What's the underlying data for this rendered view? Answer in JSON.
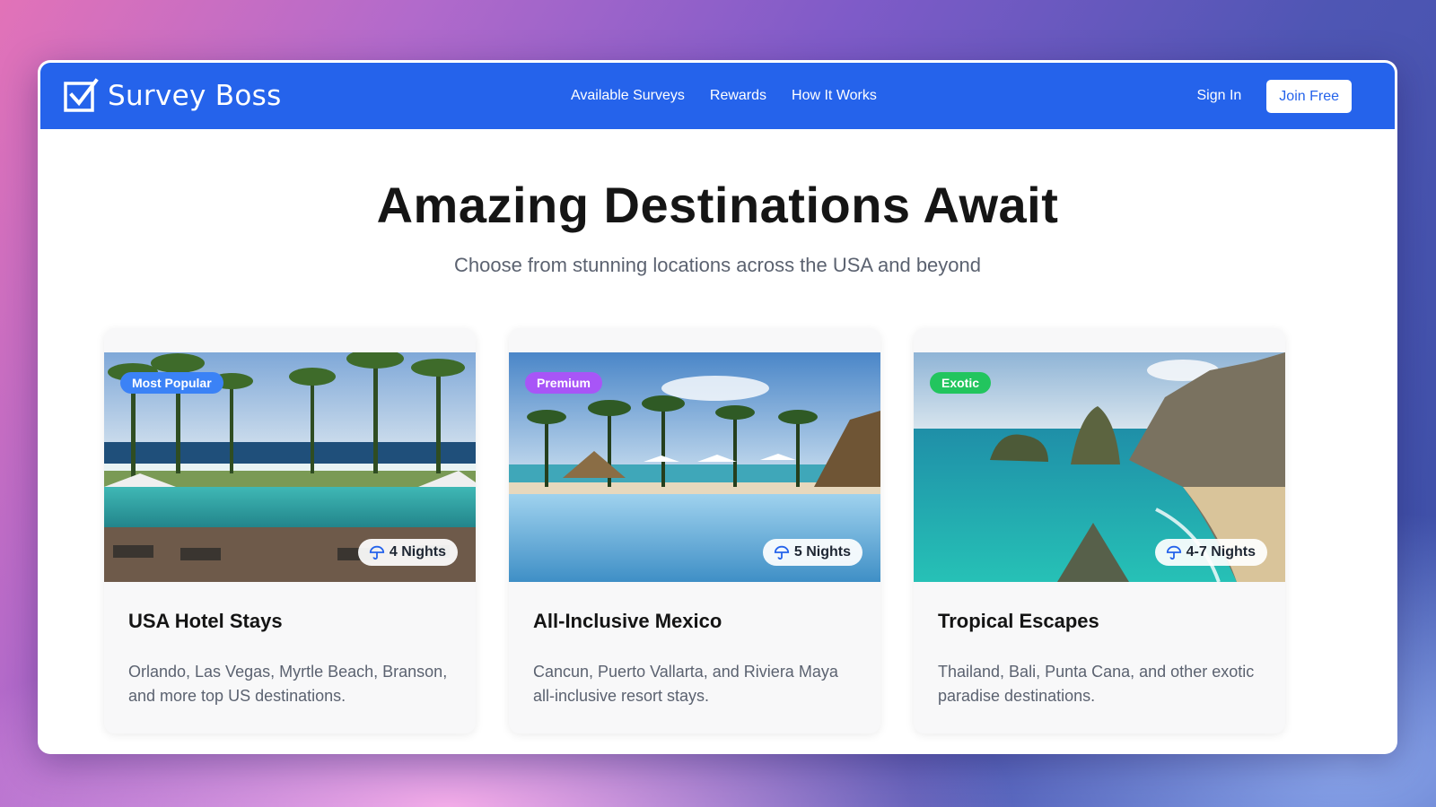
{
  "brand": {
    "name": "Survey Boss",
    "color": "#2563eb"
  },
  "nav": {
    "links": [
      "Available Surveys",
      "Rewards",
      "How It Works"
    ],
    "sign_in": "Sign In",
    "join": "Join Free"
  },
  "hero": {
    "title": "Amazing Destinations Await",
    "subtitle": "Choose from stunning locations across the USA and beyond"
  },
  "cards": [
    {
      "badge": "Most Popular",
      "badge_color": "#3b82f6",
      "nights": "4 Nights",
      "title": "USA Hotel Stays",
      "description": "Orlando, Las Vegas, Myrtle Beach, Branson, and more top US destinations.",
      "image": "resort-pool-palms-photo"
    },
    {
      "badge": "Premium",
      "badge_color": "#a855f7",
      "nights": "5 Nights",
      "title": "All-Inclusive Mexico",
      "description": "Cancun, Puerto Vallarta, and Riviera Maya all-inclusive resort stays.",
      "image": "infinity-pool-beach-photo"
    },
    {
      "badge": "Exotic",
      "badge_color": "#22c55e",
      "nights": "4-7 Nights",
      "title": "Tropical Escapes",
      "description": "Thailand, Bali, Punta Cana, and other exotic paradise destinations.",
      "image": "tropical-cliff-bay-photo"
    }
  ]
}
